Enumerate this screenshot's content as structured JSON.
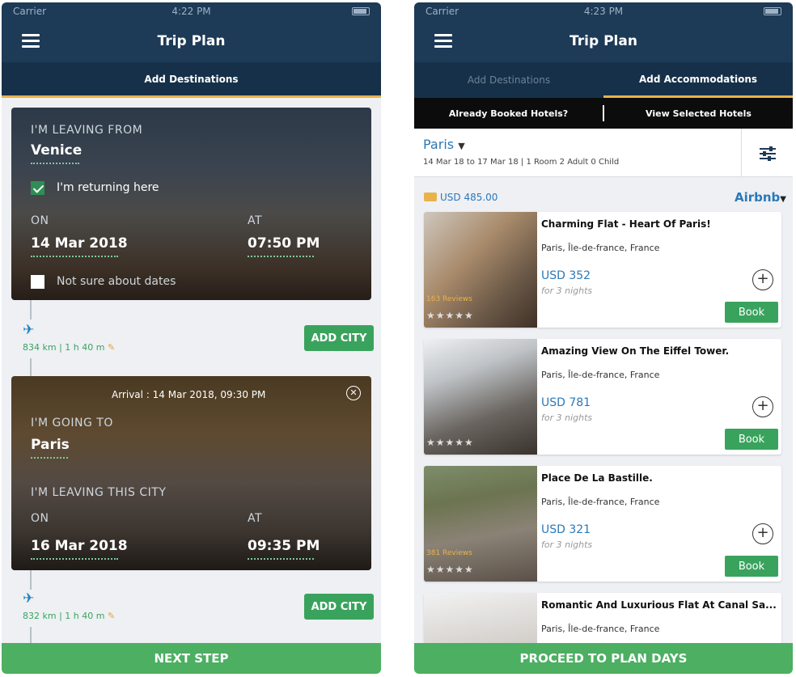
{
  "status": {
    "carrier": "Carrier"
  },
  "left": {
    "status_time": "4:22 PM",
    "title": "Trip Plan",
    "tab": "Add Destinations",
    "card1": {
      "from_label": "I'M LEAVING FROM",
      "from_city": "Venice",
      "returning_label": "I'm returning here",
      "on_label": "ON",
      "on_value": "14 Mar 2018",
      "at_label": "AT",
      "at_value": "07:50 PM",
      "not_sure_label": "Not sure about dates"
    },
    "leg1": {
      "distance": "834 km | 1 h 40 m",
      "add_city": "ADD CITY"
    },
    "card2": {
      "arrival": "Arrival : 14 Mar 2018, 09:30 PM",
      "to_label": "I'M GOING TO",
      "to_city": "Paris",
      "leaving_label": "I'M LEAVING THIS CITY",
      "on_label": "ON",
      "on_value": "16 Mar 2018",
      "at_label": "AT",
      "at_value": "09:35 PM"
    },
    "leg2": {
      "distance": "832 km | 1 h 40 m",
      "add_city": "ADD CITY"
    },
    "next_step": "NEXT STEP"
  },
  "right": {
    "status_time": "4:23 PM",
    "title": "Trip Plan",
    "tabs": [
      "Add Destinations",
      "Add Accommodations"
    ],
    "subtabs": [
      "Already Booked Hotels?",
      "View Selected Hotels"
    ],
    "city": "Paris",
    "dates": "14 Mar 18 to 17 Mar 18 | 1 Room 2 Adult 0 Child",
    "total": "USD 485.00",
    "provider": "Airbnb",
    "hotels": [
      {
        "name": "Charming Flat - Heart Of Paris!",
        "location": "Paris, Île-de-france, France",
        "price": "USD 352",
        "nights": "for 3 nights",
        "reviews": "163 Reviews",
        "book": "Book"
      },
      {
        "name": "Amazing View On The Eiffel Tower.",
        "location": "Paris, Île-de-france, France",
        "price": "USD 781",
        "nights": "for 3 nights",
        "reviews": "",
        "book": "Book"
      },
      {
        "name": "Place De La Bastille.",
        "location": "Paris, Île-de-france, France",
        "price": "USD 321",
        "nights": "for 3 nights",
        "reviews": "381 Reviews",
        "book": "Book"
      },
      {
        "name": "Romantic And Luxurious Flat At Canal Sa...",
        "location": "Paris, Île-de-france, France"
      }
    ],
    "proceed": "PROCEED TO PLAN DAYS"
  }
}
